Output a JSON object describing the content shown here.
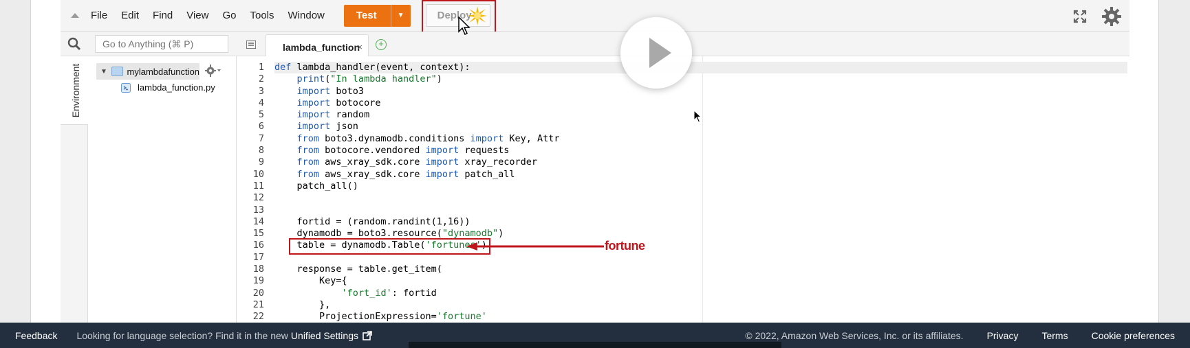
{
  "menu": {
    "items": [
      "File",
      "Edit",
      "Find",
      "View",
      "Go",
      "Tools",
      "Window"
    ],
    "test_label": "Test",
    "deploy_label": "Deploy"
  },
  "search": {
    "placeholder": "Go to Anything (⌘ P)"
  },
  "tab": {
    "label": "lambda_function",
    "close": "×",
    "add": "+"
  },
  "sidebar": {
    "environment_label": "Environment"
  },
  "tree": {
    "folder": "mylambdafunction",
    "file": "lambda_function.py"
  },
  "code": {
    "line_numbers": [
      "1",
      "2",
      "3",
      "4",
      "5",
      "6",
      "7",
      "8",
      "9",
      "10",
      "11",
      "12",
      "13",
      "14",
      "15",
      "16",
      "17",
      "18",
      "19",
      "20",
      "21",
      "22"
    ],
    "lines": [
      "def lambda_handler(event, context):",
      "    print(\"In lambda handler\")",
      "    import boto3",
      "    import botocore",
      "    import random",
      "    import json",
      "    from boto3.dynamodb.conditions import Key, Attr",
      "    from botocore.vendored import requests",
      "    from aws_xray_sdk.core import xray_recorder",
      "    from aws_xray_sdk.core import patch_all",
      "    patch_all()",
      "",
      "",
      "    fortid = (random.randint(1,16))",
      "    dynamodb = boto3.resource(\"dynamodb\")",
      "    table = dynamodb.Table('fortunes')",
      "",
      "    response = table.get_item(",
      "        Key={",
      "            'fort_id': fortid",
      "        },",
      "        ProjectionExpression='fortune'"
    ]
  },
  "annotation": {
    "label": "fortune"
  },
  "footer": {
    "feedback": "Feedback",
    "language_notice": "Looking for language selection? Find it in the new",
    "unified_settings": "Unified Settings",
    "copyright": "© 2022, Amazon Web Services, Inc. or its affiliates.",
    "privacy": "Privacy",
    "terms": "Terms",
    "cookie": "Cookie preferences"
  },
  "colors": {
    "accent": "#ec7211",
    "annotation": "#c0161b",
    "footer_bg": "#232f3e"
  }
}
